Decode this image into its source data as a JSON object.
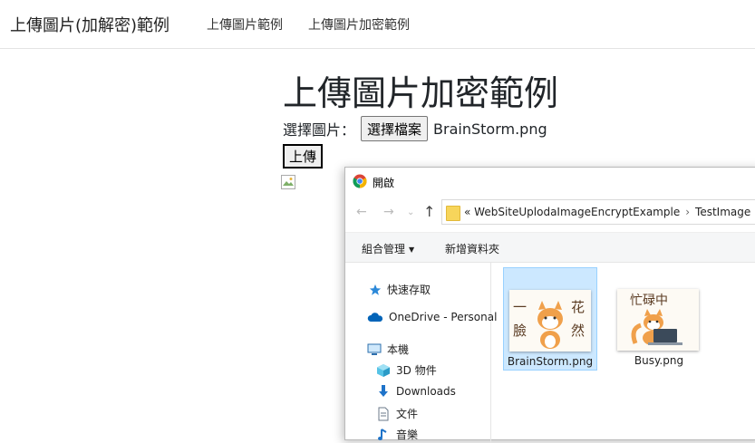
{
  "navbar": {
    "brand": "上傳圖片(加解密)範例",
    "links": [
      "上傳圖片範例",
      "上傳圖片加密範例"
    ]
  },
  "page": {
    "title": "上傳圖片加密範例",
    "file_label": "選擇圖片：",
    "file_button": "選擇檔案",
    "file_name": "BrainStorm.png",
    "upload_button": "上傳"
  },
  "dialog": {
    "title": "開啟",
    "address": {
      "prefix": "«",
      "path": [
        "WebSiteUplodaImageEncryptExample",
        "TestImage"
      ]
    },
    "commands": {
      "organize": "組合管理",
      "new_folder": "新增資料夾"
    },
    "nav_items": [
      {
        "label": "快速存取",
        "icon": "star-icon"
      },
      {
        "label": "OneDrive - Personal",
        "icon": "cloud-icon"
      },
      {
        "label": "本機",
        "icon": "computer-icon"
      },
      {
        "label": "3D 物件",
        "icon": "cube-icon"
      },
      {
        "label": "Downloads",
        "icon": "download-icon"
      },
      {
        "label": "文件",
        "icon": "document-icon"
      },
      {
        "label": "音樂",
        "icon": "music-icon"
      }
    ],
    "files": [
      {
        "name": "BrainStorm.png",
        "selected": true,
        "thumb_text": [
          "一",
          "花",
          "臉",
          "然"
        ]
      },
      {
        "name": "Busy.png",
        "selected": false,
        "thumb_text": [
          "忙碌中"
        ]
      }
    ]
  },
  "colors": {
    "selection_bg": "#cce8ff",
    "selection_border": "#99d1ff",
    "onedrive_blue": "#0364b8",
    "folder_yellow": "#f7d55b"
  }
}
